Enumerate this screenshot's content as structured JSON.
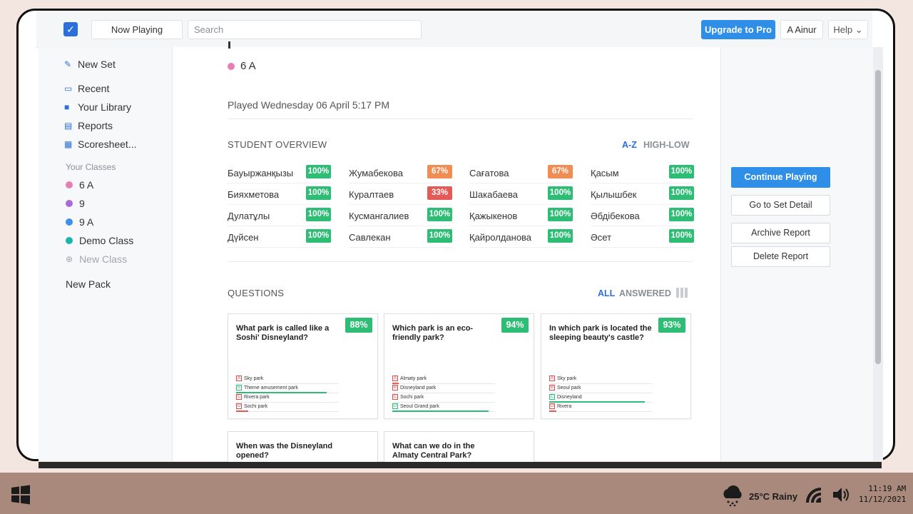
{
  "topbar": {
    "now_playing": "Now Playing",
    "search_placeholder": "Search",
    "upgrade": "Upgrade to Pro",
    "user": "A Ainur",
    "help": "Help"
  },
  "sidebar": {
    "new_set": "New Set",
    "items": [
      {
        "label": "Recent",
        "icon": "recent-icon"
      },
      {
        "label": "Your Library",
        "icon": "folder-icon"
      },
      {
        "label": "Reports",
        "icon": "report-icon"
      },
      {
        "label": "Scoresheet...",
        "icon": "grid-icon"
      }
    ],
    "your_classes": "Your Classes",
    "classes": [
      {
        "label": "6 A",
        "color": "#e97db5"
      },
      {
        "label": "9",
        "color": "#a66bd8"
      },
      {
        "label": "9 A",
        "color": "#3f8fe6"
      },
      {
        "label": "Demo Class",
        "color": "#1bb5ad"
      }
    ],
    "new_class": "New Class",
    "new_pack": "New Pack"
  },
  "main": {
    "class_tag": "6 A",
    "played": "Played Wednesday 06 April 5:17 PM",
    "student_overview": "STUDENT OVERVIEW",
    "sort_az": "A-Z",
    "sort_highlow": "HIGH-LOW",
    "students": [
      [
        {
          "name": "Бауыржанқызы",
          "pct": "100%",
          "color": "#2ebd75"
        },
        {
          "name": "Жумабекова",
          "pct": "67%",
          "color": "#ef8d55"
        },
        {
          "name": "Сағатова",
          "pct": "67%",
          "color": "#ef8d55"
        },
        {
          "name": "Қасым",
          "pct": "100%",
          "color": "#2ebd75"
        }
      ],
      [
        {
          "name": "Бияхметова",
          "pct": "100%",
          "color": "#2ebd75"
        },
        {
          "name": "Куралтаев",
          "pct": "33%",
          "color": "#e45a57"
        },
        {
          "name": "Шакабаева",
          "pct": "100%",
          "color": "#2ebd75"
        },
        {
          "name": "Қылышбек",
          "pct": "100%",
          "color": "#2ebd75"
        }
      ],
      [
        {
          "name": "Дулатұлы",
          "pct": "100%",
          "color": "#2ebd75"
        },
        {
          "name": "Кусмангалиев",
          "pct": "100%",
          "color": "#2ebd75"
        },
        {
          "name": "Қажыкенов",
          "pct": "100%",
          "color": "#2ebd75"
        },
        {
          "name": "Әбдібекова",
          "pct": "100%",
          "color": "#2ebd75"
        }
      ],
      [
        {
          "name": "Дүйсен",
          "pct": "100%",
          "color": "#2ebd75"
        },
        {
          "name": "Савлекан",
          "pct": "100%",
          "color": "#2ebd75"
        },
        {
          "name": "Қайролданова",
          "pct": "100%",
          "color": "#2ebd75"
        },
        {
          "name": "Әсет",
          "pct": "100%",
          "color": "#2ebd75"
        }
      ]
    ],
    "questions": "QUESTIONS",
    "filter_all": "ALL",
    "filter_answered": "ANSWERED",
    "question_cards": [
      {
        "text": "What park is called like a Soshi' Disneyland?",
        "pct": "88%",
        "answers": [
          {
            "l": "A",
            "t": "Sky park",
            "correct": false,
            "share": 0
          },
          {
            "l": "B",
            "t": "Theme amusement park",
            "correct": true,
            "share": 0.88
          },
          {
            "l": "C",
            "t": "Rivera park",
            "correct": false,
            "share": 0
          },
          {
            "l": "D",
            "t": "Sochi park",
            "correct": false,
            "share": 0.12
          }
        ]
      },
      {
        "text": "Which park is an eco-friendly park?",
        "pct": "94%",
        "answers": [
          {
            "l": "A",
            "t": "Almaty park",
            "correct": false,
            "share": 0.06
          },
          {
            "l": "B",
            "t": "Disneyland park",
            "correct": false,
            "share": 0
          },
          {
            "l": "C",
            "t": "Sochi park",
            "correct": false,
            "share": 0
          },
          {
            "l": "D",
            "t": "Seoul Grand park",
            "correct": true,
            "share": 0.94
          }
        ]
      },
      {
        "text": "In which park is located the sleeping beauty's castle?",
        "pct": "93%",
        "answers": [
          {
            "l": "A",
            "t": "Sky park",
            "correct": false,
            "share": 0
          },
          {
            "l": "B",
            "t": "Seoul park",
            "correct": false,
            "share": 0
          },
          {
            "l": "C",
            "t": "Disneyland",
            "correct": true,
            "share": 0.93
          },
          {
            "l": "D",
            "t": "Rivera",
            "correct": false,
            "share": 0.07
          }
        ]
      },
      {
        "text": "When was the Disneyland opened?",
        "pct": "",
        "answers": []
      },
      {
        "text": "What can we do in the Almaty Central Park?",
        "pct": "",
        "answers": []
      }
    ]
  },
  "right": {
    "continue": "Continue Playing",
    "set_detail": "Go to Set Detail",
    "archive": "Archive Report",
    "delete": "Delete Report"
  },
  "taskbar": {
    "weather": "25°C Rainy",
    "time": "11:19 AM",
    "date": "11/12/2021"
  }
}
